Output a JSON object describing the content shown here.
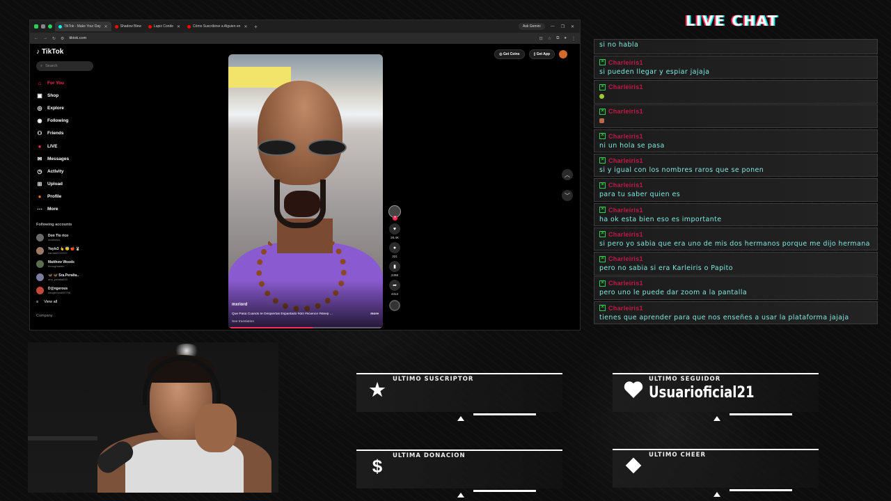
{
  "browser": {
    "tabs": [
      {
        "label": "TikTok - Make Your Day",
        "active": true,
        "color": "#00f2ea"
      },
      {
        "label": "Shadow Blew",
        "active": false,
        "color": "#ff0000"
      },
      {
        "label": "Lapiz Conde",
        "active": false,
        "color": "#ff0000"
      },
      {
        "label": "Cómo Suscribirse a Alguien en",
        "active": false,
        "color": "#ff0000"
      }
    ],
    "ask_gemini": "Ask Gemini",
    "url": "tiktok.com"
  },
  "tiktok": {
    "logo": "TikTok",
    "search_placeholder": "Search",
    "nav": [
      {
        "label": "For You",
        "icon": "home-icon",
        "active": true
      },
      {
        "label": "Shop",
        "icon": "shop-icon",
        "active": false
      },
      {
        "label": "Explore",
        "icon": "compass-icon",
        "active": false
      },
      {
        "label": "Following",
        "icon": "following-icon",
        "active": false
      },
      {
        "label": "Friends",
        "icon": "friends-icon",
        "active": false
      },
      {
        "label": "LIVE",
        "icon": "live-icon",
        "active": false
      },
      {
        "label": "Messages",
        "icon": "messages-icon",
        "active": false
      },
      {
        "label": "Activity",
        "icon": "activity-icon",
        "active": false
      },
      {
        "label": "Upload",
        "icon": "upload-icon",
        "active": false
      },
      {
        "label": "Profile",
        "icon": "profile-icon",
        "active": false
      },
      {
        "label": "More",
        "icon": "more-icon",
        "active": false
      }
    ],
    "following_title": "Following accounts",
    "following": [
      {
        "name": "Don Tlo rico",
        "handle": "dontlorico"
      },
      {
        "name": "Yayis3 👆 😇 🍎 🐰",
        "handle": "karolat2222222"
      },
      {
        "name": "Matthew Woods",
        "handle": "throughtaken"
      },
      {
        "name": "🦋 🦋 Sra.Peralta..",
        "handle": "ana_peralta300"
      },
      {
        "name": "D@ngerous",
        "handle": "dangerous690706"
      }
    ],
    "view_all": "View all",
    "company": "Company",
    "get_coins": "Get Coins",
    "get_app": "Get App",
    "video": {
      "username": "mxriord",
      "description": "Que Pasa Cuando te Despiertas Espantado #dct #science #sleep ...",
      "more": "more",
      "see_translation": "See translation",
      "progress": 0.55,
      "likes": "28.4K",
      "comments": "331",
      "saves": "2498",
      "shares": "4313"
    }
  },
  "chat": {
    "title": "LIVE CHAT",
    "messages": [
      {
        "user": "Charleiris1",
        "text": "si no habla",
        "emote": null
      },
      {
        "user": "Charleiris1",
        "text": "si pueden llegar y espiar jajaja",
        "emote": null
      },
      {
        "user": "Charleiris1",
        "text": "",
        "emote": "green"
      },
      {
        "user": "Charleiris1",
        "text": "",
        "emote": "face"
      },
      {
        "user": "Charleiris1",
        "text": "ni un hola se pasa",
        "emote": null
      },
      {
        "user": "Charleiris1",
        "text": "si y igual con los nombres raros que se ponen",
        "emote": null
      },
      {
        "user": "Charleiris1",
        "text": "para tu saber quien es",
        "emote": null
      },
      {
        "user": "Charleiris1",
        "text": "ha ok esta bien eso es importante",
        "emote": null
      },
      {
        "user": "Charleiris1",
        "text": "si pero yo sabia que era uno de mis dos hermanos porque me dijo hermana",
        "emote": null
      },
      {
        "user": "Charleiris1",
        "text": "pero no sabia si era Karleiris o Papito",
        "emote": null
      },
      {
        "user": "Charleiris1",
        "text": "pero uno le puede dar zoom a la pantalla",
        "emote": null
      },
      {
        "user": "Charleiris1",
        "text": "tienes que aprender para que nos enseñes a usar la plataforma jajaja",
        "emote": null
      }
    ]
  },
  "alerts": {
    "subscriber": {
      "label": "ULTIMO SUSCRIPTOR",
      "value": "",
      "icon": "star-icon"
    },
    "follower": {
      "label": "ULTIMO SEGUIDOR",
      "value": "Usuarioficial21",
      "icon": "heart-icon"
    },
    "donation": {
      "label": "ULTIMA DONACION",
      "value": "",
      "icon": "dollar-icon"
    },
    "cheer": {
      "label": "ULTIMO CHEER",
      "value": "",
      "icon": "diamond-icon"
    }
  }
}
